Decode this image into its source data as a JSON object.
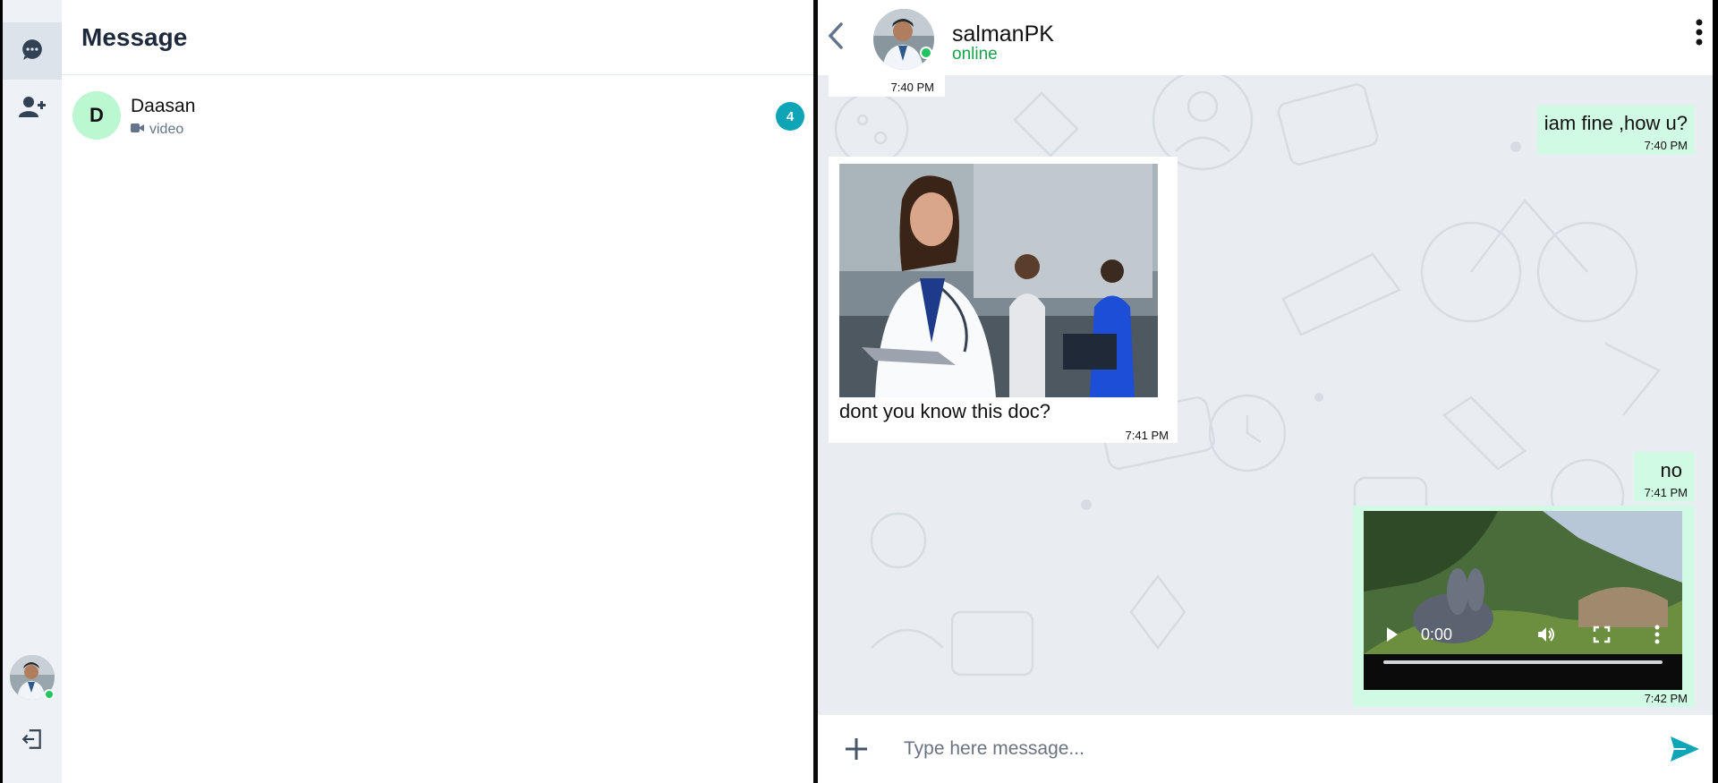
{
  "app": {
    "title": "Message"
  },
  "rail": {
    "items": [
      {
        "icon": "chat-icon",
        "active": true
      },
      {
        "icon": "add-user-icon",
        "active": false
      }
    ],
    "logout_icon": "logout-icon"
  },
  "conversations": [
    {
      "initial": "D",
      "name": "Daasan",
      "preview_icon": "video-icon",
      "preview": "video",
      "unread": "4"
    }
  ],
  "chat": {
    "contact_name": "salmanPK",
    "status": "online",
    "messages": [
      {
        "direction": "in",
        "type": "text",
        "time": "7:40 PM"
      },
      {
        "direction": "out",
        "type": "text",
        "text": "iam fine ,how u?",
        "time": "7:40 PM"
      },
      {
        "direction": "in",
        "type": "image",
        "caption": "dont you know this doc?",
        "time": "7:41 PM"
      },
      {
        "direction": "out",
        "type": "text",
        "text": "no",
        "time": "7:41 PM"
      },
      {
        "direction": "out",
        "type": "video",
        "player_time": "0:00",
        "time": "7:42 PM"
      }
    ],
    "composer": {
      "placeholder": "Type here message..."
    }
  },
  "colors": {
    "accent": "#0ea5b7",
    "online": "#22c55e",
    "outgoing_bubble": "#d1fae5",
    "unread_badge": "#0ea5b7"
  }
}
